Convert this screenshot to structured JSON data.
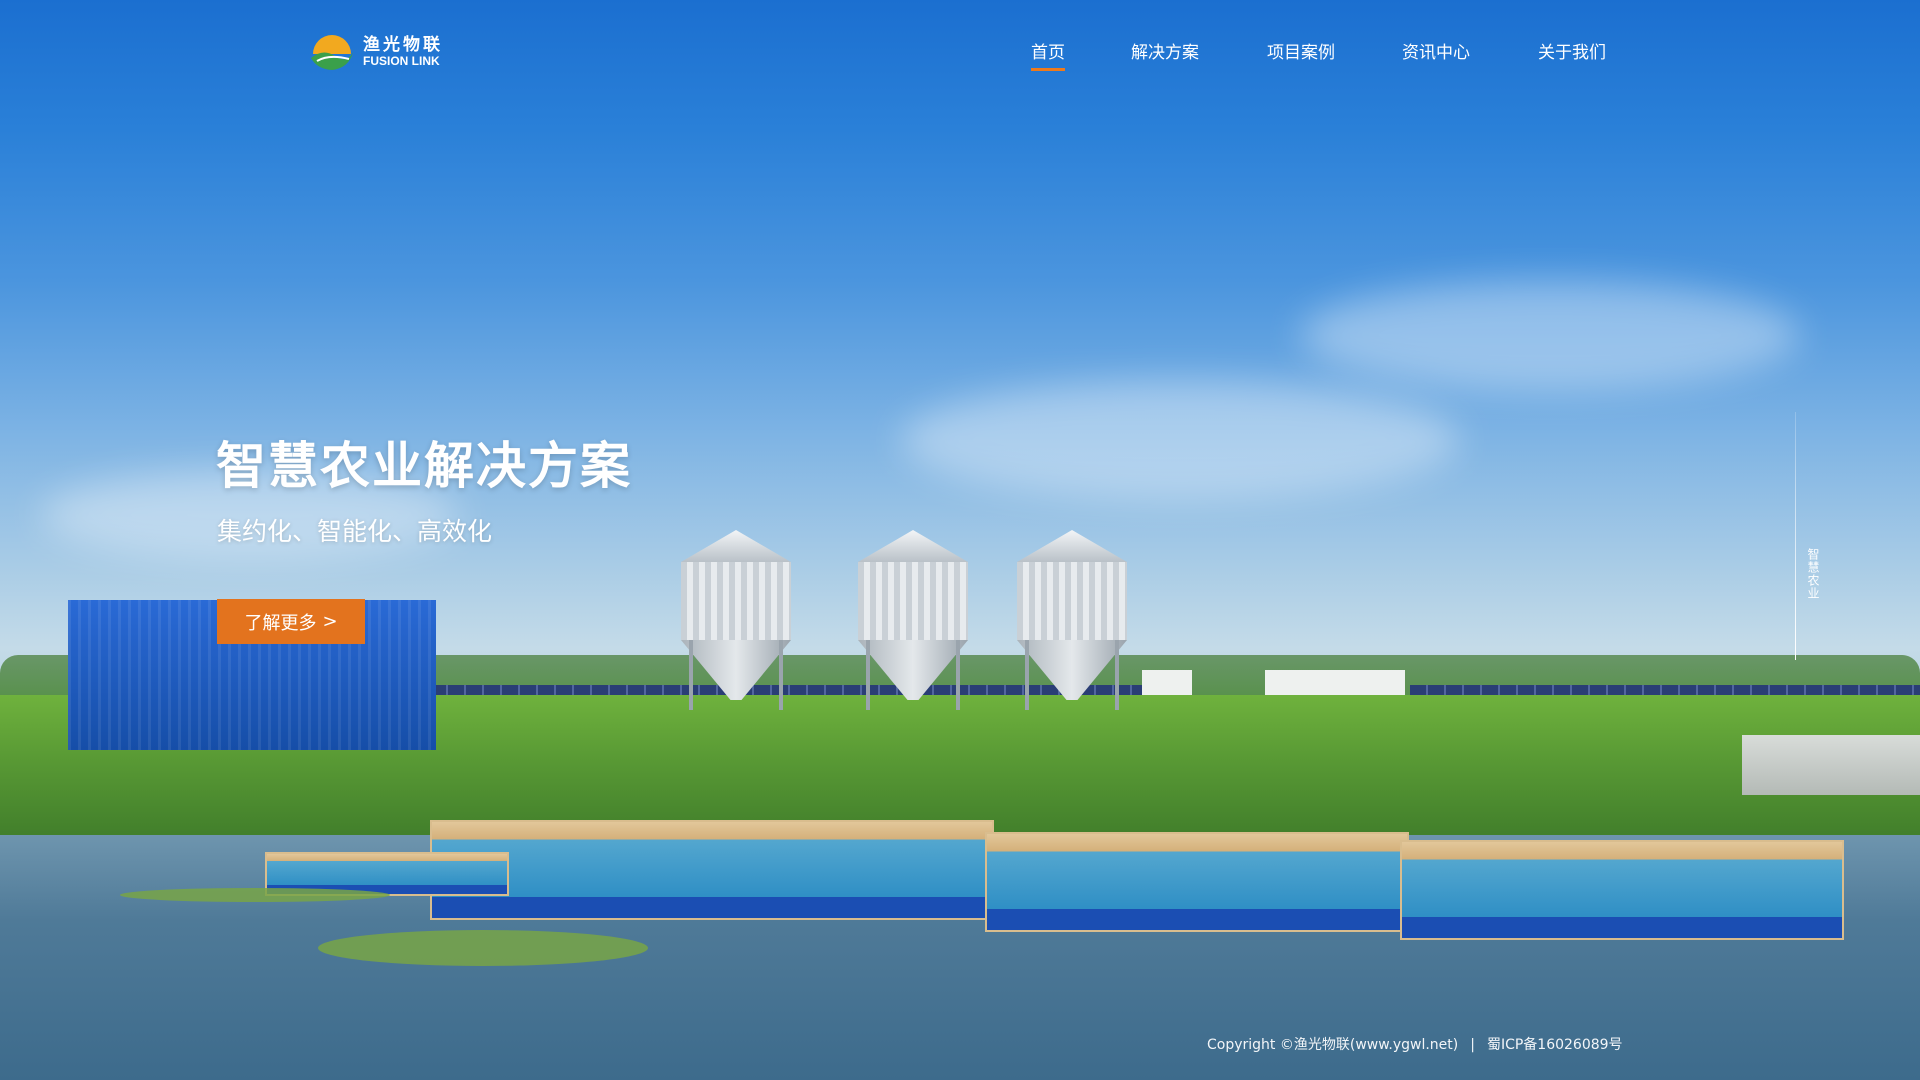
{
  "brand": {
    "name_cn": "渔光物联",
    "name_en": "FUSION LINK",
    "colors": {
      "accent": "#e3731e",
      "sky": "#1b6fd0",
      "leaf": "#3aa04a",
      "sun": "#f2a91f"
    }
  },
  "nav": {
    "items": [
      {
        "label": "首页",
        "active": true
      },
      {
        "label": "解决方案",
        "active": false
      },
      {
        "label": "项目案例",
        "active": false
      },
      {
        "label": "资讯中心",
        "active": false
      },
      {
        "label": "关于我们",
        "active": false
      }
    ]
  },
  "hero": {
    "title": "智慧农业解决方案",
    "subtitle": "集约化、智能化、高效化",
    "cta_label": "了解更多",
    "cta_icon": "chevron-right-icon"
  },
  "side_indicator": {
    "label": "智慧农业"
  },
  "footer": {
    "copyright": "Copyright ©渔光物联(www.ygwl.net)",
    "separator": "|",
    "icp": "蜀ICP备16026089号"
  }
}
